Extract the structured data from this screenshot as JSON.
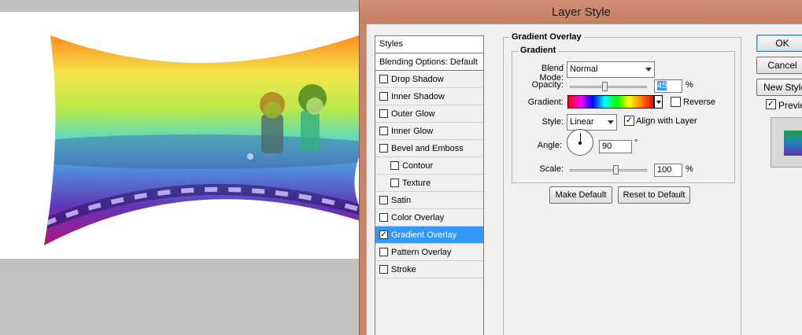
{
  "dialog": {
    "title": "Layer Style"
  },
  "style_list": {
    "header": "Styles",
    "items": [
      {
        "label": "Blending Options: Default",
        "checkbox": false,
        "checked": false,
        "indent": false,
        "selected": false
      },
      {
        "label": "Drop Shadow",
        "checkbox": true,
        "checked": false,
        "indent": false,
        "selected": false
      },
      {
        "label": "Inner Shadow",
        "checkbox": true,
        "checked": false,
        "indent": false,
        "selected": false
      },
      {
        "label": "Outer Glow",
        "checkbox": true,
        "checked": false,
        "indent": false,
        "selected": false
      },
      {
        "label": "Inner Glow",
        "checkbox": true,
        "checked": false,
        "indent": false,
        "selected": false
      },
      {
        "label": "Bevel and Emboss",
        "checkbox": true,
        "checked": false,
        "indent": false,
        "selected": false
      },
      {
        "label": "Contour",
        "checkbox": true,
        "checked": false,
        "indent": true,
        "selected": false
      },
      {
        "label": "Texture",
        "checkbox": true,
        "checked": false,
        "indent": true,
        "selected": false
      },
      {
        "label": "Satin",
        "checkbox": true,
        "checked": false,
        "indent": false,
        "selected": false
      },
      {
        "label": "Color Overlay",
        "checkbox": true,
        "checked": false,
        "indent": false,
        "selected": false
      },
      {
        "label": "Gradient Overlay",
        "checkbox": true,
        "checked": true,
        "indent": false,
        "selected": true
      },
      {
        "label": "Pattern Overlay",
        "checkbox": true,
        "checked": false,
        "indent": false,
        "selected": false
      },
      {
        "label": "Stroke",
        "checkbox": true,
        "checked": false,
        "indent": false,
        "selected": false
      }
    ]
  },
  "panel": {
    "group_title": "Gradient Overlay",
    "subgroup_title": "Gradient",
    "blend_mode_label": "Blend Mode:",
    "blend_mode_value": "Normal",
    "opacity_label": "Opacity:",
    "opacity_value": "45",
    "opacity_level": 0.45,
    "percent": "%",
    "gradient_label": "Gradient:",
    "reverse_label": "Reverse",
    "reverse_checked": false,
    "style_label": "Style:",
    "style_value": "Linear",
    "align_label": "Align with Layer",
    "align_checked": true,
    "angle_label": "Angle:",
    "angle_value": "90",
    "degree": "°",
    "scale_label": "Scale:",
    "scale_value": "100",
    "scale_level": 0.6,
    "make_default": "Make Default",
    "reset_default": "Reset to Default"
  },
  "buttons": {
    "ok": "OK",
    "cancel": "Cancel",
    "new_style": "New Style...",
    "preview": "Preview",
    "preview_checked": true
  },
  "colors": {
    "titlebar": "#c9836a",
    "selection": "#3399ff"
  }
}
